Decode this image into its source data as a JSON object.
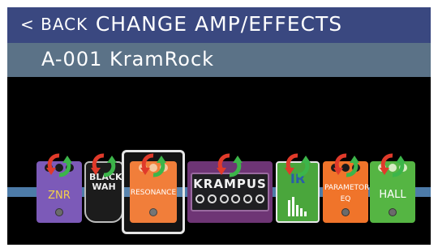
{
  "header": {
    "back_label": "< BACK",
    "title": "CHANGE AMP/EFFECTS"
  },
  "patch": {
    "name": "A-001 KramRock"
  },
  "effects": [
    {
      "name": "ZNR",
      "color": "#7c5ab8"
    },
    {
      "name": "BLACK WAH",
      "color": "#1c1c1c"
    },
    {
      "name": "RESONANCE",
      "color": "#f0742a"
    },
    {
      "name": "KRAMPUS",
      "color": "#6e3575"
    },
    {
      "name": "IR",
      "color": "#4aa63c"
    },
    {
      "name": "PARAMETORIC EQ",
      "color": "#f0742a"
    },
    {
      "name": "HALL",
      "color": "#55b543"
    }
  ],
  "selected_effect": "RESONANCE",
  "colors": {
    "header_bg": "#3a4880",
    "patch_bg": "#5b7287",
    "chain_line": "#4d7ba8",
    "arrow_red": "#e03a2a",
    "arrow_green": "#3cb54a"
  },
  "icons": {
    "swap": "swap-arrows-icon",
    "ir_bars": "bar-graph-icon"
  }
}
